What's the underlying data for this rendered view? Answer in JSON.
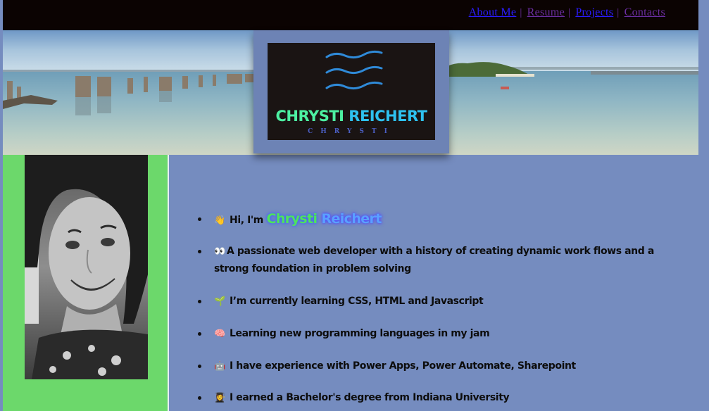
{
  "nav": {
    "items": [
      {
        "label": "About Me ",
        "state": "link"
      },
      {
        "label": "Resume ",
        "state": "visited"
      },
      {
        "label": "Projects ",
        "state": "link"
      },
      {
        "label": "Contacts",
        "state": "visited"
      }
    ],
    "separator": "|"
  },
  "logo": {
    "first_name": "CHRYSTI",
    "last_name": "REICHERT",
    "sub": "CHRYSTI",
    "colors": {
      "first": "#4df0a2",
      "last": "#2ec1ef",
      "waves": "#2f8ad8"
    }
  },
  "intro": {
    "greeting_prefix": "Hi, I'm",
    "first_name": "Chrysti",
    "last_name": "Reichert"
  },
  "bullets": [
    {
      "icon": "waving-hand-icon",
      "glyph": "👋",
      "text": "Hi, I'm"
    },
    {
      "icon": "eyes-icon",
      "glyph": "👀",
      "text": "A passionate web developer with a history of creating dynamic work flows and a strong foundation in problem solving"
    },
    {
      "icon": "seedling-icon",
      "glyph": "🌱",
      "text": "I’m currently learning CSS, HTML and Javascript"
    },
    {
      "icon": "brain-icon",
      "glyph": "🧠",
      "text": "Learning new programming languages in my jam"
    },
    {
      "icon": "robot-icon",
      "glyph": "🤖",
      "text": "I have experience with Power Apps, Power Automate, Sharepoint"
    },
    {
      "icon": "graduate-icon",
      "glyph": "👩‍🎓",
      "text": "I earned a Bachelor's degree from Indiana University"
    }
  ],
  "colors": {
    "background": "#758cbf",
    "topbar": "#0b0302",
    "sidebar": "#6cd86b",
    "link": "#2a1cff",
    "visited": "#6b2ea1"
  }
}
